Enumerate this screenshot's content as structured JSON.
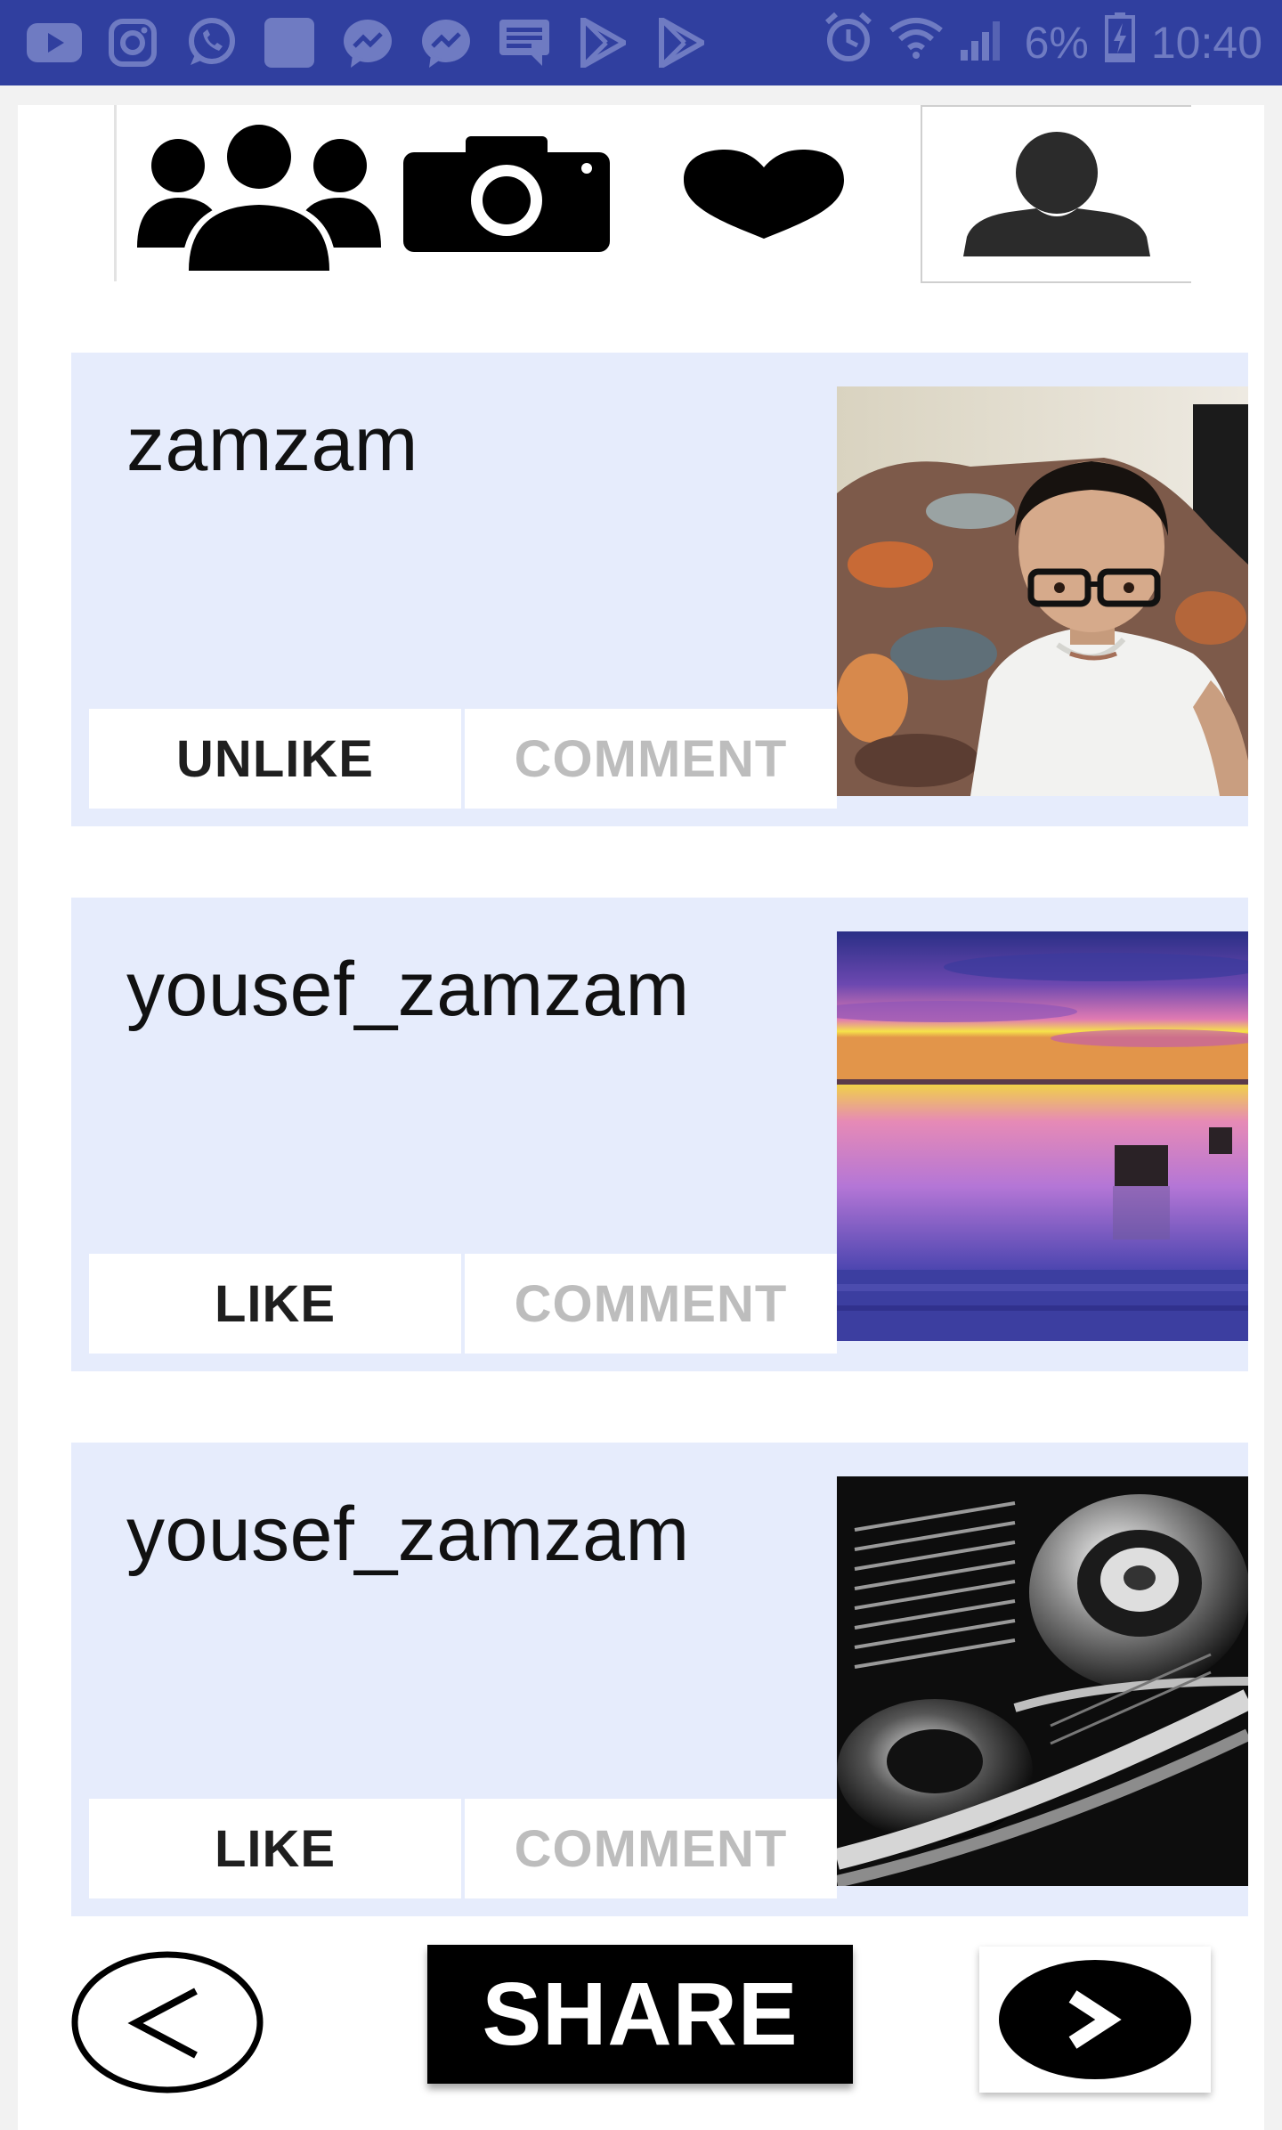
{
  "status_bar": {
    "left_icons": [
      "youtube-icon",
      "instagram-icon",
      "whatsapp-icon",
      "app-square-icon",
      "messenger-icon",
      "messenger-icon",
      "message-icon",
      "play-store-icon",
      "play-store-icon"
    ],
    "battery_percent": "6%",
    "time": "10:40",
    "right_icons": [
      "alarm-icon",
      "wifi-icon",
      "signal-icon",
      "battery-charging-icon"
    ],
    "background_color": "#303f9f",
    "icon_color": "#6f7bc2"
  },
  "toolbar": {
    "items": [
      {
        "icon": "friends-icon"
      },
      {
        "icon": "camera-icon"
      },
      {
        "icon": "heart-icon"
      },
      {
        "icon": "profile-icon"
      }
    ]
  },
  "posts": [
    {
      "username": "zamzam",
      "like_label": "UNLIKE",
      "comment_label": "COMMENT",
      "photo": "selfie-photo"
    },
    {
      "username": "yousef_zamzam",
      "like_label": "LIKE",
      "comment_label": "COMMENT",
      "photo": "sunset-lake-photo"
    },
    {
      "username": "yousef_zamzam",
      "like_label": "LIKE",
      "comment_label": "COMMENT",
      "photo": "motorcycle-engine-photo"
    }
  ],
  "bottom_bar": {
    "back_icon": "chevron-left-icon",
    "share_label": "SHARE",
    "next_icon": "chevron-right-icon"
  },
  "colors": {
    "card_background": "#e6ecfc",
    "comment_text": "#bdbdbd",
    "share_background": "#000000"
  }
}
